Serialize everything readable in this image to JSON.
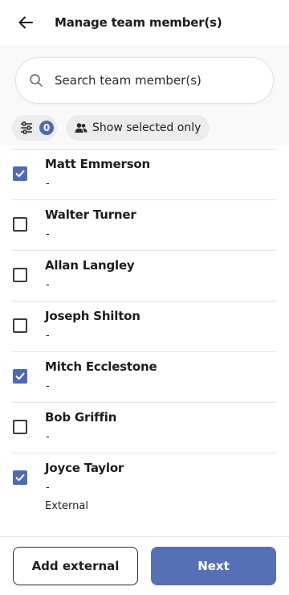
{
  "header": {
    "title": "Manage team member(s)",
    "back_icon": "arrow-left-icon"
  },
  "search": {
    "placeholder": "Search team member(s)",
    "value": "",
    "icon": "search-icon"
  },
  "filters": {
    "filter_count": "0",
    "filter_icon": "sliders-icon",
    "show_selected_label": "Show selected only",
    "show_selected_icon": "people-icon"
  },
  "members": [
    {
      "name": "Matt Emmerson",
      "sub": "-",
      "tag": "",
      "checked": true
    },
    {
      "name": "Walter Turner",
      "sub": "-",
      "tag": "",
      "checked": false
    },
    {
      "name": "Allan Langley",
      "sub": "-",
      "tag": "",
      "checked": false
    },
    {
      "name": "Joseph Shilton",
      "sub": "-",
      "tag": "",
      "checked": false
    },
    {
      "name": "Mitch Ecclestone",
      "sub": "-",
      "tag": "",
      "checked": true
    },
    {
      "name": "Bob Griffin",
      "sub": "-",
      "tag": "",
      "checked": false
    },
    {
      "name": "Joyce Taylor",
      "sub": "-",
      "tag": "External",
      "checked": true
    }
  ],
  "footer": {
    "add_external_label": "Add external",
    "next_label": "Next"
  },
  "colors": {
    "accent": "#4f6ab3",
    "primary_button": "#5570b4",
    "chip_bg": "#ececec",
    "search_zone_bg": "#f9f9f9"
  }
}
